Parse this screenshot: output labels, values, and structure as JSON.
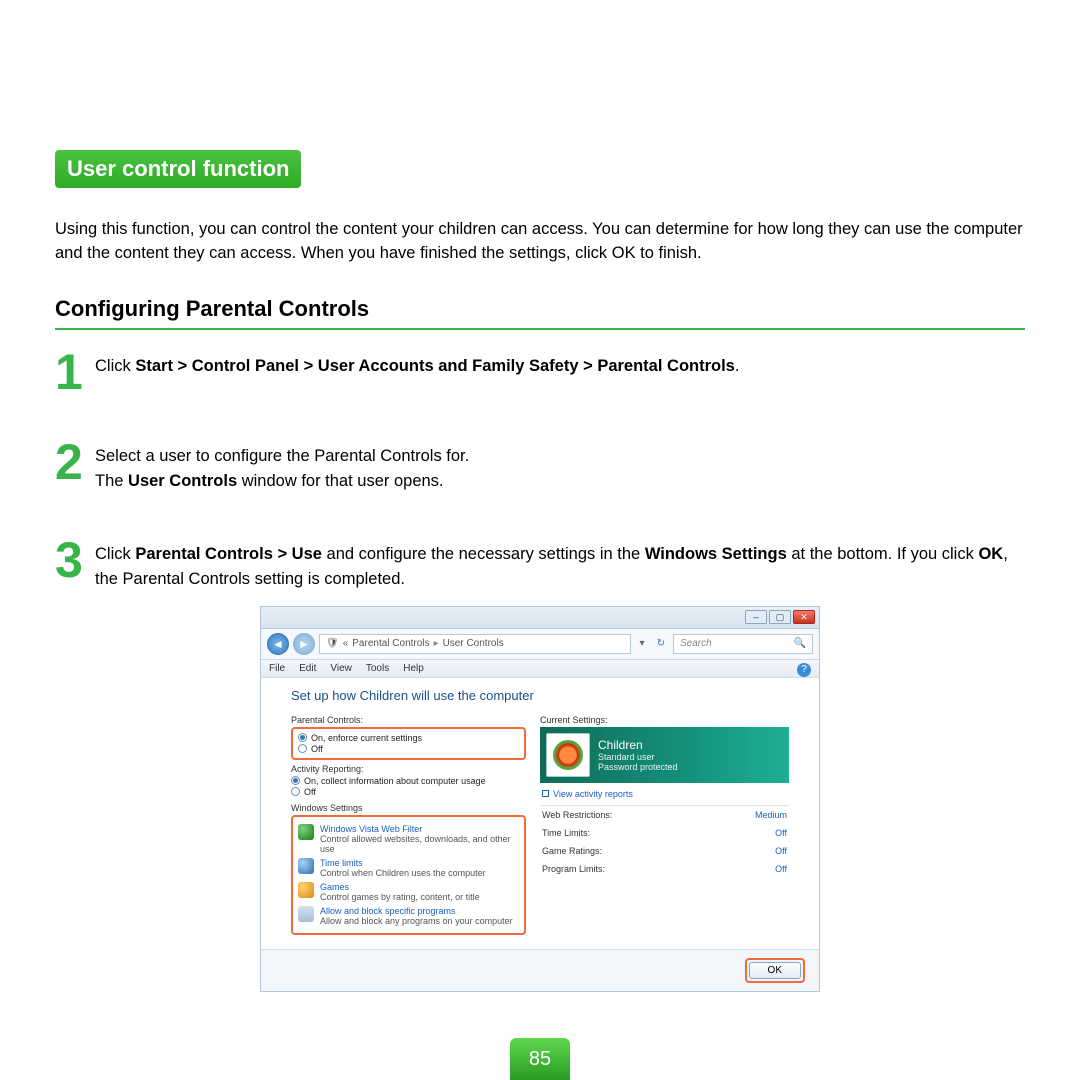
{
  "title": "User control function",
  "intro": "Using this function, you can control the content your children can access. You can determine for how long they can use the computer and the content they can access. When you have finished the settings, click OK to finish.",
  "subheading": "Configuring Parental Controls",
  "steps": {
    "s1_pre": "Click ",
    "s1_bold": "Start > Control Panel > User Accounts and Family Safety > Parental Controls",
    "s1_post": ".",
    "s2_a": "Select a user to configure the Parental Controls for.",
    "s2_b_pre": "The ",
    "s2_b_bold": "User Controls",
    "s2_b_post": " window for that user opens.",
    "s3_pre": "Click ",
    "s3_b1": "Parental Controls > Use",
    "s3_mid1": " and configure the necessary settings in the ",
    "s3_b2": "Windows Settings",
    "s3_mid2": " at the bottom. If you click ",
    "s3_b3": "OK",
    "s3_post": ", the Parental Controls setting is completed."
  },
  "page_number": "85",
  "screenshot": {
    "breadcrumb": {
      "a": "Parental Controls",
      "b": "User Controls"
    },
    "search_placeholder": "Search",
    "menubar": [
      "File",
      "Edit",
      "View",
      "Tools",
      "Help"
    ],
    "heading": "Set up how Children will use the computer",
    "group_pc": "Parental Controls:",
    "pc_on": "On, enforce current settings",
    "pc_off": "Off",
    "group_ar": "Activity Reporting:",
    "ar_on": "On, collect information about computer usage",
    "ar_off": "Off",
    "group_ws": "Windows Settings",
    "ws_items": [
      {
        "link": "Windows Vista Web Filter",
        "desc": "Control allowed websites, downloads, and other use"
      },
      {
        "link": "Time limits",
        "desc": "Control when Children uses the computer"
      },
      {
        "link": "Games",
        "desc": "Control games by rating, content, or title"
      },
      {
        "link": "Allow and block specific programs",
        "desc": "Allow and block any programs on your computer"
      }
    ],
    "right_heading": "Current Settings:",
    "user": {
      "name": "Children",
      "role": "Standard user",
      "pw": "Password protected"
    },
    "view_reports": "View activity reports",
    "current": [
      {
        "k": "Web Restrictions:",
        "v": "Medium"
      },
      {
        "k": "Time Limits:",
        "v": "Off"
      },
      {
        "k": "Game Ratings:",
        "v": "Off"
      },
      {
        "k": "Program Limits:",
        "v": "Off"
      }
    ],
    "ok": "OK"
  }
}
